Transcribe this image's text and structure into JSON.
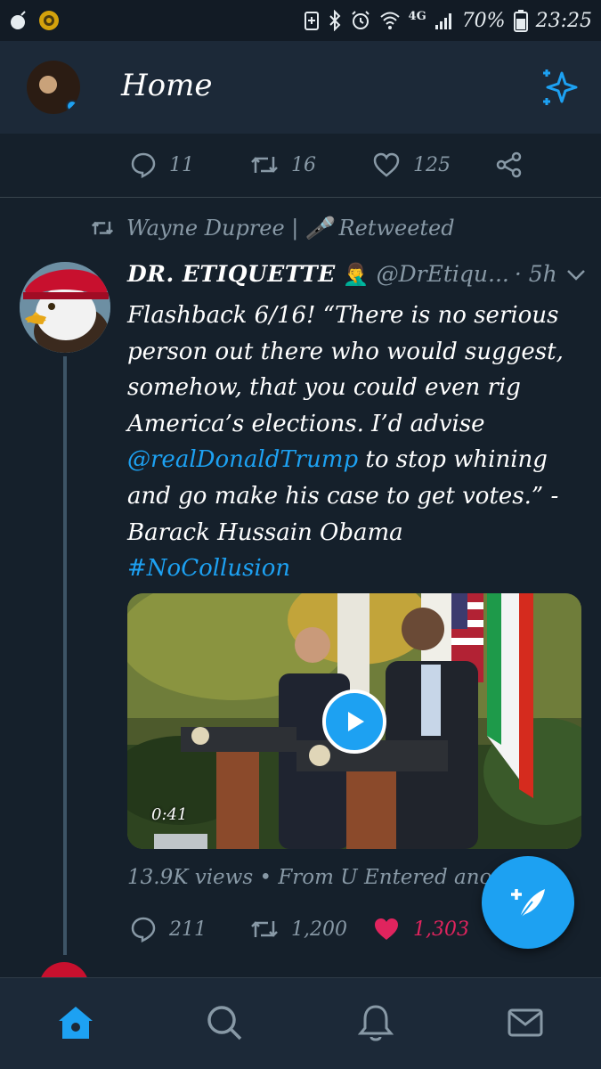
{
  "status_bar": {
    "network": "4G",
    "battery": "70%",
    "time": "23:25"
  },
  "header": {
    "title": "Home"
  },
  "previous_tweet": {
    "replies": "11",
    "retweets": "16",
    "likes": "125"
  },
  "retweet_context": {
    "text": "Wayne Dupree | 🎤 Retweeted"
  },
  "tweet": {
    "name": "DR. ETIQUETTE",
    "emoji": "🤦‍♂️",
    "handle": "@DrEtiqu...",
    "time": "· 5h",
    "text_1": "Flashback 6/16!  “There is no serious person out there who would suggest, somehow, that you could even rig America’s elections. I’d advise ",
    "mention": "@realDonaldTrump",
    "text_2": " to stop whining and go make his case to get votes.” -Barack Hussain Obama",
    "hashtag": "#NoCollusion",
    "video_duration": "0:41",
    "views_line": "13.9K views • From U Entered another",
    "replies": "211",
    "retweets": "1,200",
    "likes": "1,303"
  },
  "colors": {
    "background": "#15202b",
    "bar": "#1c2938",
    "accent": "#1da1f2",
    "like": "#e0245e",
    "muted": "#8899a6"
  },
  "icons": [
    "reply-icon",
    "retweet-icon",
    "like-icon",
    "share-icon",
    "sparkle-icon",
    "compose-icon",
    "home-icon",
    "search-icon",
    "notifications-icon",
    "messages-icon",
    "play-icon"
  ]
}
